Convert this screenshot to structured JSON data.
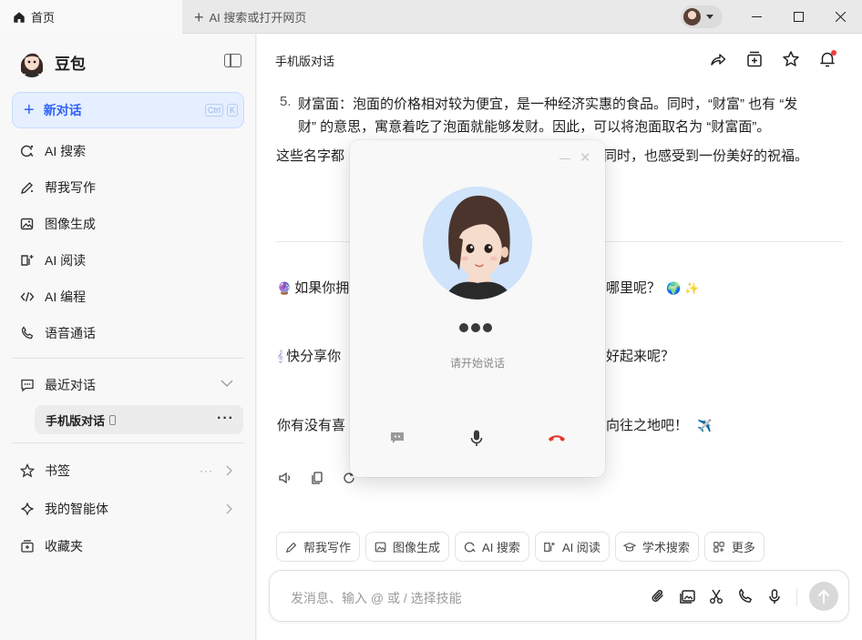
{
  "titlebar": {
    "active_tab_label": "首页",
    "new_tab_label": "AI 搜索或打开网页"
  },
  "sidebar": {
    "brand_name": "豆包",
    "new_chat_label": "新对话",
    "new_chat_shortcut": [
      "Ctrl",
      "K"
    ],
    "nav_items": [
      {
        "label": "AI 搜索",
        "icon": "ai-search-icon"
      },
      {
        "label": "帮我写作",
        "icon": "pen-icon"
      },
      {
        "label": "图像生成",
        "icon": "image-icon"
      },
      {
        "label": "AI 阅读",
        "icon": "reading-icon"
      },
      {
        "label": "AI 编程",
        "icon": "code-icon"
      },
      {
        "label": "语音通话",
        "icon": "phone-icon"
      }
    ],
    "recent_label": "最近对话",
    "recent_item_label": "手机版对话",
    "bookmarks_label": "书签",
    "agents_label": "我的智能体",
    "favorites_label": "收藏夹"
  },
  "main": {
    "title": "手机版对话",
    "list_item_number": "5.",
    "list_item_text_1": "财富面：泡面的价格相对较为便宜，是一种经济实惠的食品。同时，“财富” 也有 “发",
    "list_item_text_2": "财” 的意思，寓意着吃了泡面就能够发财。因此，可以将泡面取名为 “财富面”。",
    "summary_left": "这些名字都",
    "summary_right": "同时，也感受到一份美好的祝福。",
    "suggest_1_left": "如果你拥",
    "suggest_1_right": "哪里呢？",
    "suggest_2_left": "快分享你",
    "suggest_2_right": "好起来呢？",
    "suggest_3_left": "你有没有喜",
    "suggest_3_right": "向往之地吧！",
    "chips": [
      {
        "label": "帮我写作",
        "icon": "pen-icon"
      },
      {
        "label": "图像生成",
        "icon": "image-icon"
      },
      {
        "label": "AI 搜索",
        "icon": "ai-search-icon"
      },
      {
        "label": "AI 阅读",
        "icon": "reading-icon"
      },
      {
        "label": "学术搜索",
        "icon": "academic-icon"
      },
      {
        "label": "更多",
        "icon": "more-grid-icon"
      }
    ],
    "input_placeholder": "发消息、输入 @ 或 / 选择技能"
  },
  "call_popup": {
    "status_text": "请开始说话",
    "end_call_color": "#e8362d"
  },
  "colors": {
    "accent": "#2e63f5",
    "accent_bg": "#e5efff"
  }
}
